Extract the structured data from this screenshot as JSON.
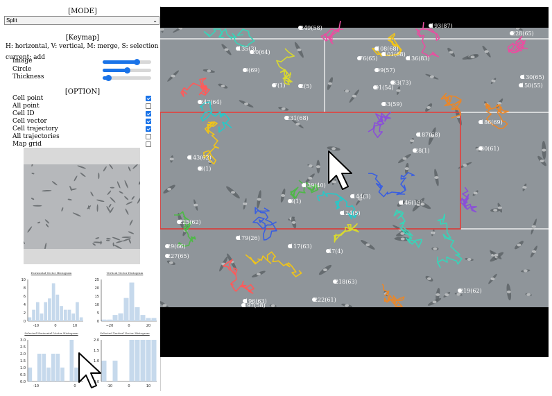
{
  "sidebar": {
    "mode_title": "[MODE]",
    "mode_value": "Split",
    "keymap_title": "[Keymap]",
    "keymap_text": "H: horizontal, V: vertical, M: merge, S: selection",
    "current_text": "current: add",
    "sliders": [
      {
        "label": "Image",
        "value": 0.7
      },
      {
        "label": "Circle",
        "value": 0.5
      },
      {
        "label": "Thickness",
        "value": 0.12
      }
    ],
    "option_title": "[OPTION]",
    "options": [
      {
        "label": "Cell point",
        "checked": true
      },
      {
        "label": "All point",
        "checked": false
      },
      {
        "label": "Cell ID",
        "checked": true
      },
      {
        "label": "Cell vector",
        "checked": true
      },
      {
        "label": "Cell trajectory",
        "checked": true
      },
      {
        "label": "All trajectories",
        "checked": false
      },
      {
        "label": "Map grid",
        "checked": false
      }
    ]
  },
  "histograms": [
    {
      "title": "Horizontal Vector Histogram",
      "categories": [
        -15,
        -12,
        -10,
        -8,
        -6,
        -4,
        -2,
        0,
        2,
        4,
        6,
        8,
        10,
        12
      ],
      "values": [
        1,
        3,
        5,
        2,
        5,
        6,
        10,
        7,
        4,
        3,
        3,
        2,
        5,
        1
      ],
      "ylim": [
        0,
        11
      ],
      "yticks": [
        "10",
        "8",
        "6",
        "4",
        "2",
        "0"
      ],
      "xticks": [
        "-10",
        "0",
        "10"
      ]
    },
    {
      "title": "Vertical Vector Histogram",
      "categories": [
        -20,
        -15,
        -10,
        -5,
        -3,
        0,
        2,
        4,
        6,
        20
      ],
      "values": [
        1,
        1,
        4,
        5,
        15,
        25,
        9,
        4,
        2,
        2
      ],
      "ylim": [
        0,
        27
      ],
      "yticks": [
        "25",
        "20",
        "15",
        "10",
        "5",
        "0"
      ],
      "xticks": [
        "−20",
        "0",
        "20"
      ]
    },
    {
      "title": "Selected Horizontal Vector Histogram",
      "categories": [
        -15,
        -12,
        -10,
        -8,
        -6,
        -4,
        -2,
        0,
        2,
        4,
        6,
        8
      ],
      "values": [
        1,
        0,
        2,
        2,
        1,
        2,
        2,
        1,
        0,
        3,
        1,
        0
      ],
      "ylim": [
        0,
        3
      ],
      "yticks": [
        "3.0",
        "2.5",
        "2.0",
        "1.5",
        "1.0",
        "0.5",
        "0.0"
      ],
      "xticks": [
        "-10",
        "0"
      ]
    },
    {
      "title": "Selected Vertical Vector Histogram",
      "categories": [
        -15,
        -12,
        -10,
        -5,
        -2,
        0,
        2,
        5,
        8,
        10
      ],
      "values": [
        1,
        0,
        1,
        0,
        0,
        2,
        2,
        2,
        2,
        2
      ],
      "ylim": [
        0,
        2
      ],
      "yticks": [
        "2.0",
        "1.5",
        "1.0",
        "0.5",
        "0.0"
      ],
      "xticks": [
        "-10",
        "0",
        "10"
      ]
    }
  ],
  "cell_labels": [
    "249(58)",
    "193(87)",
    "228(65)",
    "135(3)",
    "20(64)",
    "108(68)",
    "101(68)",
    "76(65)",
    "136(83)",
    "9(69)",
    "99(57)",
    "130(65)",
    "7(1)",
    "91(54)",
    "83(73)",
    "2(5)",
    "150(55)",
    "247(64)",
    "53(59)",
    "231(68)",
    "187(68)",
    "186(69)",
    "30(61)",
    "143(62)",
    "28(1)",
    "3(1)",
    "139(40)",
    "144(3)",
    "6(1)",
    "146(19)",
    "124(5)",
    "225(62)",
    "179(26)",
    "117(63)",
    "29(66)",
    "227(65)",
    "47(4)",
    "196(63)",
    "218(63)",
    "219(62)",
    "197(58)",
    "222(61)"
  ]
}
